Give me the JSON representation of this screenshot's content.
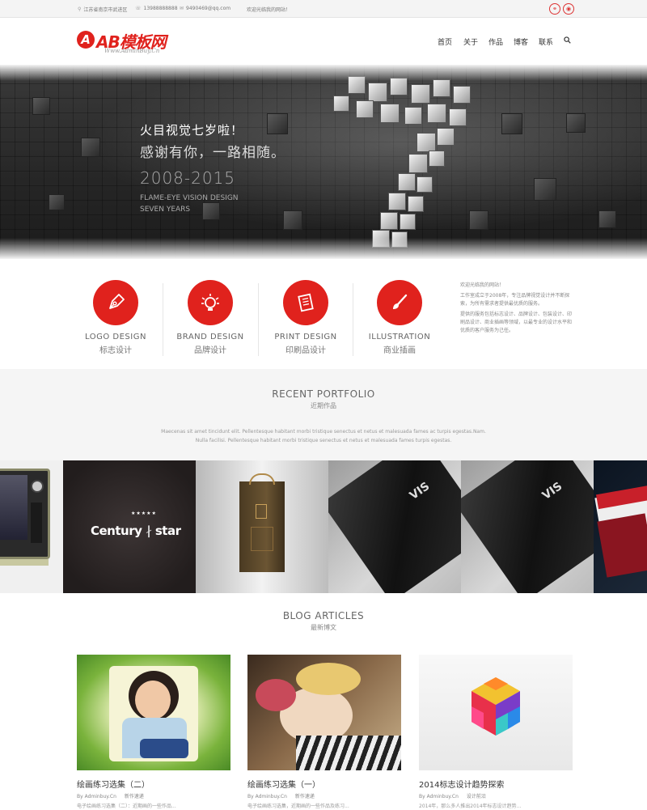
{
  "topbar": {
    "address": "江苏省南京市武进区",
    "phone": "13988888888",
    "email": "9490469@qq.com",
    "welcome": "欢迎光临我的网站！"
  },
  "header": {
    "logo_text": "AB模板网",
    "logo_sub": "Www.AdminBuy.Cn",
    "nav": [
      "首页",
      "关于",
      "作品",
      "博客",
      "联系"
    ]
  },
  "hero": {
    "line1": "火目视觉七岁啦！",
    "line2": "感谢有你，一路相随。",
    "years": "2008-2015",
    "en1": "FLAME-EYE VISION DESIGN",
    "en2": "SEVEN YEARS"
  },
  "services": [
    {
      "en": "LOGO DESIGN",
      "cn": "标志设计",
      "icon": "pen-nib-icon"
    },
    {
      "en": "BRAND DESIGN",
      "cn": "品牌设计",
      "icon": "lightbulb-icon"
    },
    {
      "en": "PRINT DESIGN",
      "cn": "印刷品设计",
      "icon": "print-document-icon"
    },
    {
      "en": "ILLUSTRATION",
      "cn": "商业插画",
      "icon": "paintbrush-icon"
    }
  ],
  "intro": {
    "p1": "欢迎光临我的网站！",
    "p2": "工作室成立于2008年，专注品牌视觉设计并不断探索，为所有需求者提供最优质的服务。",
    "p3": "提供的服务包括标志设计、品牌设计、包装设计、印刷品设计、商业插画等领域，以最专业的设计水平和优质的客户服务为己任。"
  },
  "recent": {
    "title": "RECENT PORTFOLIO",
    "subtitle": "近期作品",
    "desc1": "Maecenas sit amet tincidunt elit. Pellentesque habitant morbi tristique senectus et netus et malesuada fames ac turpis egestas.Nam.",
    "desc2": "Nulla facilisi. Pellentesque habitant morbi tristique senectus et netus et malesuada fames turpis egestas."
  },
  "portfolio": {
    "century_brand": "Century",
    "century_brand2": "star",
    "vis_text": "VIS"
  },
  "blog": {
    "title": "BLOG ARTICLES",
    "subtitle": "最新博文",
    "posts": [
      {
        "title": "绘画练习选集（二）",
        "author": "By Adminbuy.Cn",
        "category": "新作速递",
        "excerpt": "电子绘画练习选集（二）：近期画的一些作品..."
      },
      {
        "title": "绘画练习选集（一）",
        "author": "By Adminbuy.Cn",
        "category": "新作速递",
        "excerpt": "电子绘画练习选集，近期画的一些作品及练习..."
      },
      {
        "title": "2014标志设计趋势探索",
        "author": "By Adminbuy.Cn",
        "category": "设计前沿",
        "excerpt": "2014年，那么多人推出2014年标志设计趋势..."
      }
    ]
  },
  "colors": {
    "accent": "#e0221d",
    "topbar_bg": "#f4f4f4",
    "section_bg": "#f5f5f5"
  }
}
